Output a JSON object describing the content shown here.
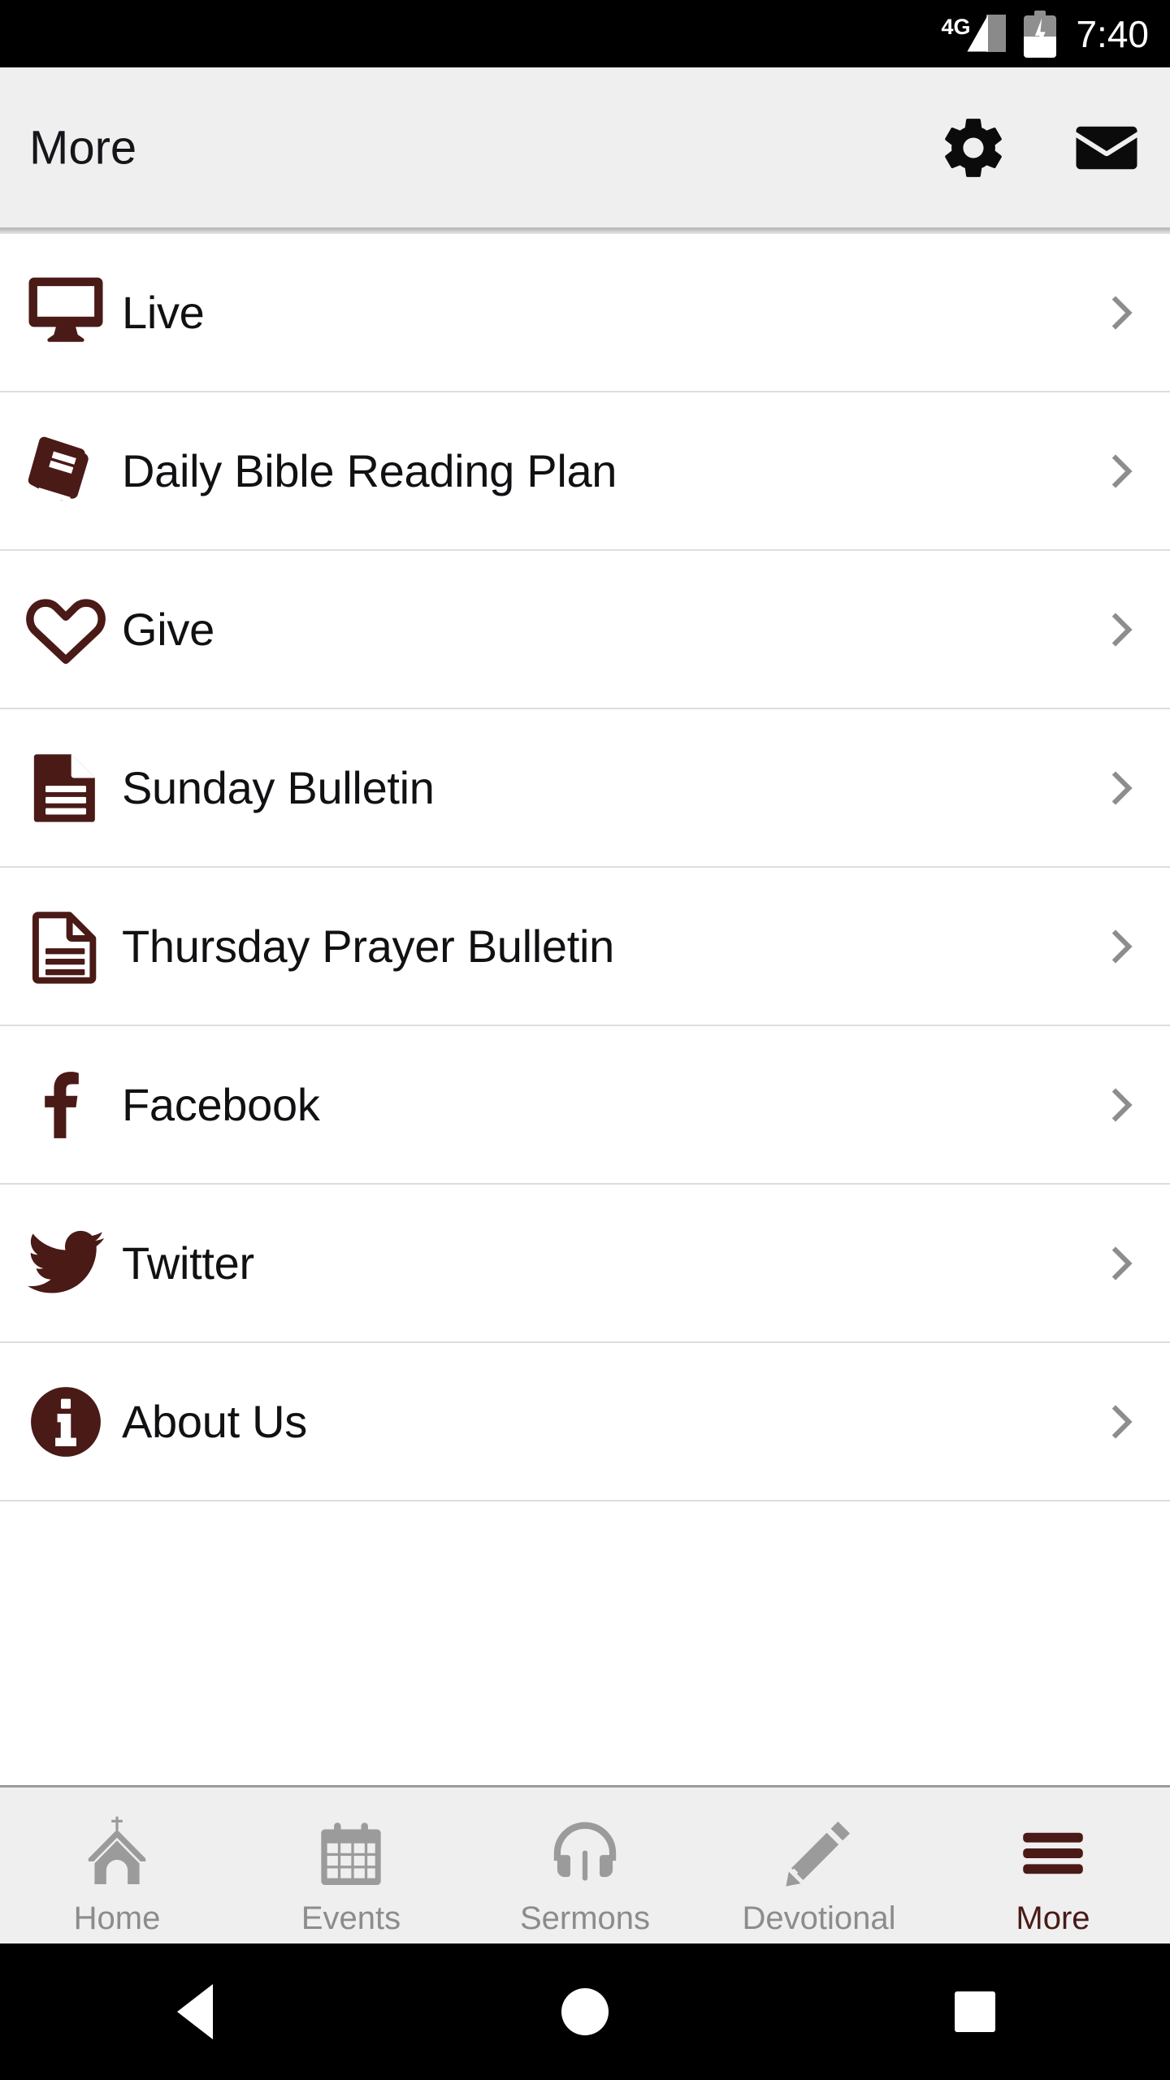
{
  "status_bar": {
    "network_label": "4G",
    "time": "7:40",
    "battery_state": "charging",
    "signal_icon": "signal-bars-icon",
    "battery_icon": "battery-charging-icon"
  },
  "header": {
    "title": "More",
    "settings_icon": "gear-icon",
    "mail_icon": "envelope-icon"
  },
  "theme": {
    "accent": "#4a1a17",
    "header_bg": "#efeff0",
    "text": "#111114",
    "muted": "#8c8c8c",
    "divider": "#dedede"
  },
  "list": {
    "items": [
      {
        "label": "Live",
        "icon": "monitor-icon",
        "chevron": "chevron-right-icon"
      },
      {
        "label": "Daily Bible Reading Plan",
        "icon": "book-icon",
        "chevron": "chevron-right-icon"
      },
      {
        "label": "Give",
        "icon": "heart-outline-icon",
        "chevron": "chevron-right-icon"
      },
      {
        "label": "Sunday Bulletin",
        "icon": "document-filled-icon",
        "chevron": "chevron-right-icon"
      },
      {
        "label": "Thursday Prayer Bulletin",
        "icon": "document-outline-icon",
        "chevron": "chevron-right-icon"
      },
      {
        "label": "Facebook",
        "icon": "facebook-icon",
        "chevron": "chevron-right-icon"
      },
      {
        "label": "Twitter",
        "icon": "twitter-icon",
        "chevron": "chevron-right-icon"
      },
      {
        "label": "About Us",
        "icon": "info-circle-icon",
        "chevron": "chevron-right-icon"
      }
    ]
  },
  "tab_bar": {
    "items": [
      {
        "label": "Home",
        "icon": "church-icon",
        "active": false
      },
      {
        "label": "Events",
        "icon": "calendar-icon",
        "active": false
      },
      {
        "label": "Sermons",
        "icon": "headphones-icon",
        "active": false
      },
      {
        "label": "Devotional",
        "icon": "pencil-icon",
        "active": false
      },
      {
        "label": "More",
        "icon": "hamburger-icon",
        "active": true
      }
    ]
  },
  "system_nav": {
    "back": "back-triangle-icon",
    "home": "home-circle-icon",
    "recents": "recents-square-icon"
  }
}
